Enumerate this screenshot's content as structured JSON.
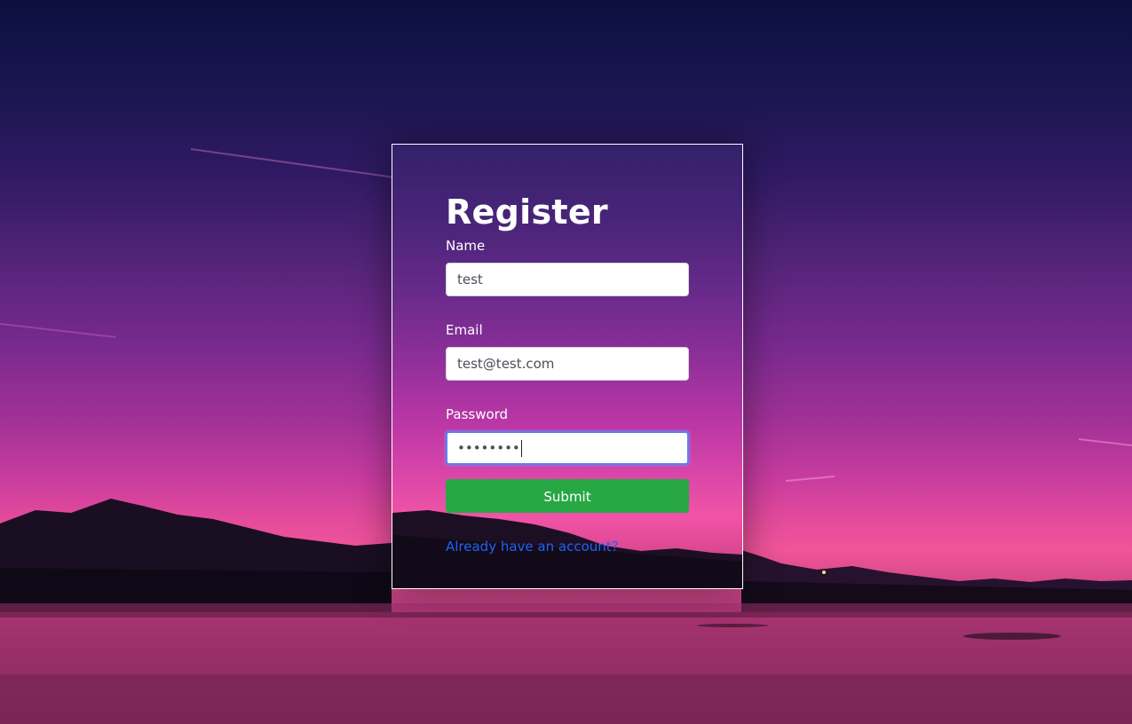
{
  "form": {
    "title": "Register",
    "name": {
      "label": "Name",
      "value": "test"
    },
    "email": {
      "label": "Email",
      "value": "test@test.com"
    },
    "password": {
      "label": "Password",
      "value": "••••••••"
    },
    "submit_label": "Submit",
    "login_link": "Already have an account?"
  },
  "colors": {
    "submit": "#28a745",
    "link": "#1e63f5",
    "focus_ring": "#5b7ff0"
  }
}
